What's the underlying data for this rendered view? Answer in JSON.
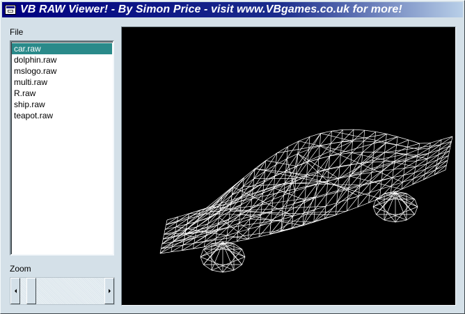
{
  "window": {
    "title": "VB RAW Viewer! - By Simon Price - visit www.VBgames.co.uk for more!",
    "app_icon": "app-window-icon"
  },
  "file_panel": {
    "label": "File",
    "items": [
      {
        "label": "car.raw",
        "selected": true
      },
      {
        "label": "dolphin.raw",
        "selected": false
      },
      {
        "label": "mslogo.raw",
        "selected": false
      },
      {
        "label": "multi.raw",
        "selected": false
      },
      {
        "label": "R.raw",
        "selected": false
      },
      {
        "label": "ship.raw",
        "selected": false
      },
      {
        "label": "teapot.raw",
        "selected": false
      }
    ]
  },
  "zoom": {
    "label": "Zoom",
    "value_fraction": 0.08,
    "left_icon": "scroll-left-arrow-icon",
    "right_icon": "scroll-right-arrow-icon"
  },
  "viewport": {
    "content": "wireframe car model",
    "background_color": "#000000",
    "wire_color": "#ffffff"
  },
  "colors": {
    "selection": "#2a8a8a",
    "title_start": "#000080",
    "title_end": "#b8cfe8"
  }
}
